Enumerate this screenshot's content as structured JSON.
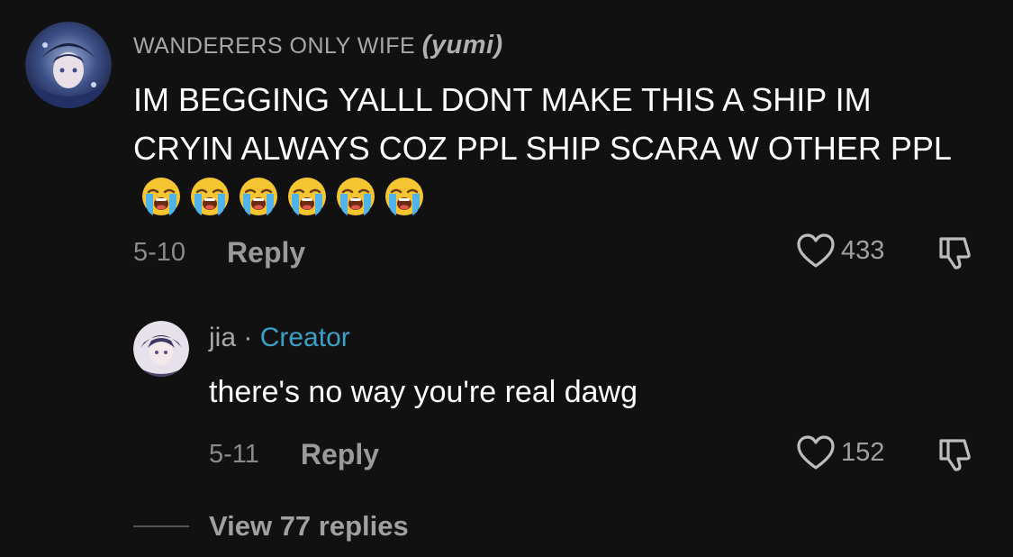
{
  "comments": [
    {
      "username": "WANDERERS ONLY WIFE",
      "nickname": "(yumi)",
      "text": "IM BEGGING YALLL DONT MAKE THIS A SHIP IM CRYIN ALWAYS COZ PPL SHIP SCARA W OTHER PPL",
      "emoji_count": 6,
      "date": "5-10",
      "reply_label": "Reply",
      "likes": "433"
    },
    {
      "username": "jia",
      "separator": "·",
      "badge": "Creator",
      "text": "there's no way you're real dawg",
      "date": "5-11",
      "reply_label": "Reply",
      "likes": "152"
    }
  ],
  "view_replies": "View 77 replies",
  "colors": {
    "background": "#111111",
    "creator_badge": "#3aa0c8",
    "muted_text": "#a0a0a0"
  },
  "icons": [
    "heart-outline-icon",
    "thumbs-down-icon",
    "loudly-crying-face-emoji"
  ]
}
